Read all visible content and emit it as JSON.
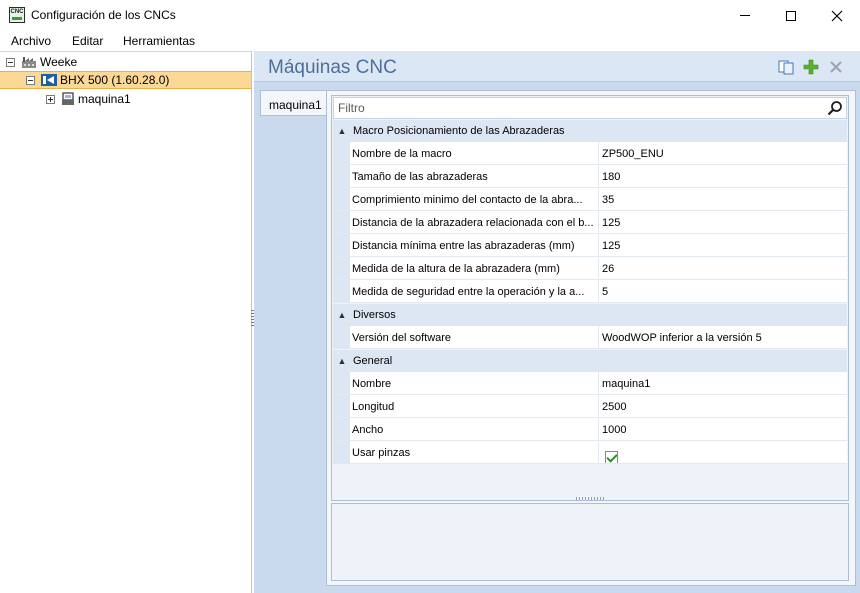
{
  "window": {
    "title": "Configuración de los CNCs",
    "icon_label": "CNC"
  },
  "menu": [
    "Archivo",
    "Editar",
    "Herramientas"
  ],
  "tree": {
    "root": {
      "label": "Weeke"
    },
    "machine": {
      "label": "BHX 500 (1.60.28.0)"
    },
    "child": {
      "label": "maquina1"
    }
  },
  "panel": {
    "title": "Máquinas CNC",
    "tab": "maquina1",
    "filter_placeholder": "Filtro"
  },
  "categories": [
    {
      "label": "Macro Posicionamiento de las Abrazaderas",
      "rows": [
        {
          "name": "Nombre de la macro",
          "value": "ZP500_ENU"
        },
        {
          "name": "Tamaño de las abrazaderas",
          "value": "180"
        },
        {
          "name": "Comprimiento minimo del contacto de la abra...",
          "value": "35"
        },
        {
          "name": "Distancia de la abrazadera relacionada con el b...",
          "value": "125"
        },
        {
          "name": "Distancia mínima entre las abrazaderas (mm)",
          "value": "125"
        },
        {
          "name": "Medida de la altura de la abrazadera (mm)",
          "value": "26"
        },
        {
          "name": "Medida de seguridad entre la operación y la a...",
          "value": "5"
        }
      ]
    },
    {
      "label": "Diversos",
      "rows": [
        {
          "name": "Versión del software",
          "value": "WoodWOP inferior a la versión 5"
        }
      ]
    },
    {
      "label": "General",
      "rows": [
        {
          "name": "Nombre",
          "value": "maquina1"
        },
        {
          "name": "Longitud",
          "value": "2500"
        },
        {
          "name": "Ancho",
          "value": "1000"
        },
        {
          "name": "Usar pinzas",
          "value": "",
          "checked": true
        }
      ]
    }
  ],
  "colors": {
    "accent_title": "#4e6e97",
    "selection": "#fcd897",
    "panel_bg": "#dce7f5"
  }
}
